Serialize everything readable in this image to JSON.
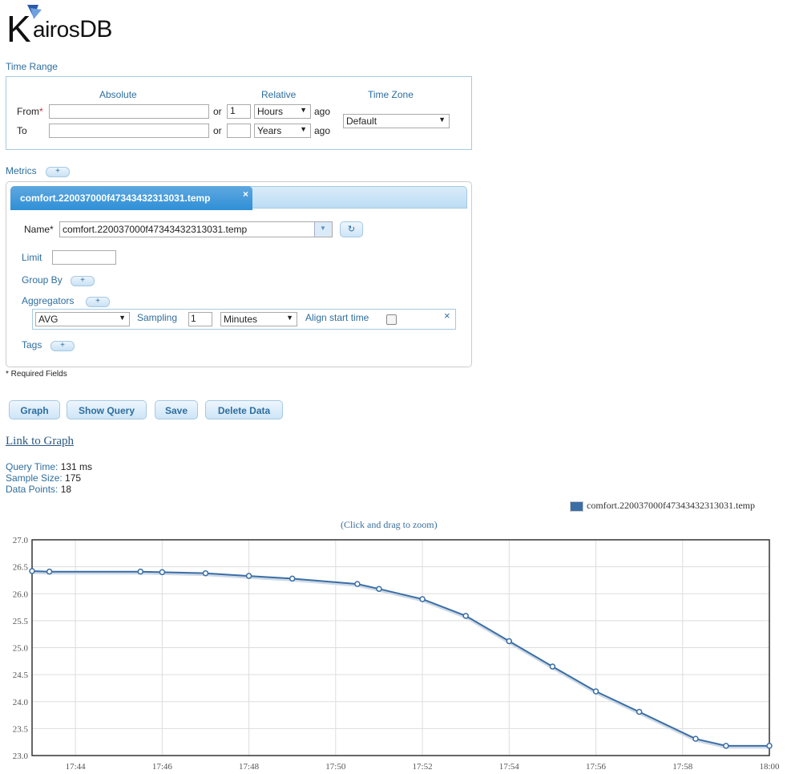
{
  "logo": {
    "text_a": "airos",
    "text_b": "DB",
    "letter": "K"
  },
  "time_range": {
    "title": "Time Range",
    "absolute_label": "Absolute",
    "relative_label": "Relative",
    "timezone_label": "Time Zone",
    "from_label": "From",
    "to_label": "To",
    "required_mark": "*",
    "or_label": "or",
    "ago_label": "ago",
    "from_absolute": "",
    "to_absolute": "",
    "from_relative_value": "1",
    "from_relative_unit": "Hours",
    "to_relative_value": "",
    "to_relative_unit": "Years",
    "timezone_value": "Default"
  },
  "metrics": {
    "title": "Metrics",
    "tab_label": "comfort.220037000f47343432313031.temp",
    "tab_close": "×",
    "name_label": "Name",
    "name_value": "comfort.220037000f47343432313031.temp",
    "limit_label": "Limit",
    "limit_value": "",
    "group_by_label": "Group By",
    "aggregators_label": "Aggregators",
    "aggregator": {
      "type": "AVG",
      "sampling_label": "Sampling",
      "sampling_value": "1",
      "sampling_unit": "Minutes",
      "align_label": "Align start time",
      "align_checked": false,
      "remove": "×"
    },
    "tags_label": "Tags"
  },
  "required_note": "* Required Fields",
  "buttons": {
    "graph": "Graph",
    "show_query": "Show Query",
    "save": "Save",
    "delete_data": "Delete Data"
  },
  "link_to_graph": "Link to Graph",
  "stats": {
    "query_time_label": "Query Time:",
    "query_time_value": "131 ms",
    "sample_size_label": "Sample Size:",
    "sample_size_value": "175",
    "data_points_label": "Data Points:",
    "data_points_value": "18"
  },
  "zoom_hint": "(Click and drag to zoom)",
  "colors": {
    "accent": "#2e6e9e",
    "series": "#3b6ea5"
  },
  "chart_data": {
    "type": "line",
    "series": [
      {
        "name": "comfort.220037000f47343432313031.temp",
        "x": [
          "17:43:00",
          "17:43:24",
          "17:45:30",
          "17:46:00",
          "17:47:00",
          "17:48:00",
          "17:49:00",
          "17:50:30",
          "17:51:00",
          "17:52:00",
          "17:53:00",
          "17:54:00",
          "17:55:00",
          "17:56:00",
          "17:57:00",
          "17:58:18",
          "17:59:00",
          "18:00:00"
        ],
        "values": [
          26.42,
          26.41,
          26.41,
          26.4,
          26.38,
          26.33,
          26.28,
          26.18,
          26.09,
          25.9,
          25.59,
          25.12,
          24.65,
          24.19,
          23.81,
          23.31,
          23.18,
          23.18
        ]
      }
    ],
    "xticks": [
      "17:44",
      "17:46",
      "17:48",
      "17:50",
      "17:52",
      "17:54",
      "17:56",
      "17:58",
      "18:00"
    ],
    "yticks": [
      "23.0",
      "23.5",
      "24.0",
      "24.5",
      "25.0",
      "25.5",
      "26.0",
      "26.5",
      "27.0"
    ],
    "ylim": [
      23.0,
      27.0
    ],
    "xlim": [
      "17:43:00",
      "18:00:00"
    ],
    "grid": true,
    "legend": "top-right"
  }
}
